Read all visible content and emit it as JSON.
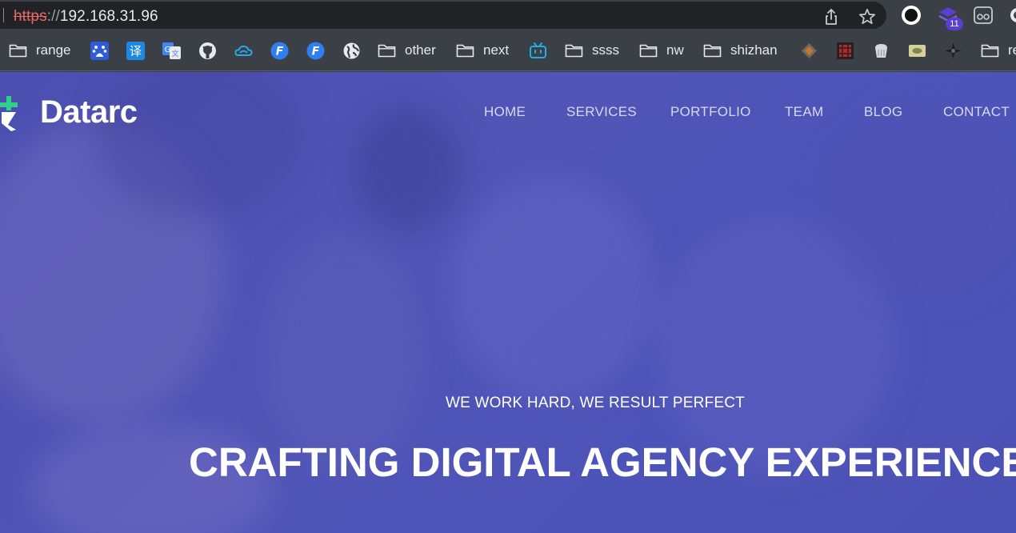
{
  "browser": {
    "url_scheme": "https",
    "url_separator": "://",
    "url_host": "192.168.31.96",
    "extension_badge": "11",
    "bookmarks": [
      {
        "type": "folder",
        "label": "range"
      },
      {
        "type": "icon",
        "icon": "baidu-icon"
      },
      {
        "type": "icon",
        "icon": "translate-icon"
      },
      {
        "type": "icon",
        "icon": "google-translate-icon"
      },
      {
        "type": "icon",
        "icon": "github-icon"
      },
      {
        "type": "icon",
        "icon": "cloud-icon"
      },
      {
        "type": "icon",
        "icon": "f-app-icon"
      },
      {
        "type": "icon",
        "icon": "f-app-icon"
      },
      {
        "type": "icon",
        "icon": "globe-icon"
      },
      {
        "type": "folder",
        "label": "other"
      },
      {
        "type": "folder",
        "label": "next"
      },
      {
        "type": "icon",
        "icon": "bilibili-icon"
      },
      {
        "type": "folder",
        "label": "ssss"
      },
      {
        "type": "folder",
        "label": "nw"
      },
      {
        "type": "folder",
        "label": "shizhan"
      },
      {
        "type": "icon",
        "icon": "site-favicon"
      },
      {
        "type": "icon",
        "icon": "site-favicon"
      },
      {
        "type": "icon",
        "icon": "site-favicon"
      },
      {
        "type": "icon",
        "icon": "site-favicon"
      },
      {
        "type": "icon",
        "icon": "site-favicon"
      },
      {
        "type": "folder",
        "label": "re"
      }
    ]
  },
  "site": {
    "logo_text": "Datarc",
    "nav": [
      "HOME",
      "SERVICES",
      "PORTFOLIO",
      "TEAM",
      "BLOG",
      "CONTACT"
    ],
    "tagline": "WE WORK HARD, WE RESULT PERFECT",
    "headline": "CRAFTING DIGITAL AGENCY EXPERIENCES"
  },
  "colors": {
    "hero_overlay": "#4d52b5",
    "logo_accent": "#2fd08a",
    "chrome_bg": "#3b3f46"
  }
}
